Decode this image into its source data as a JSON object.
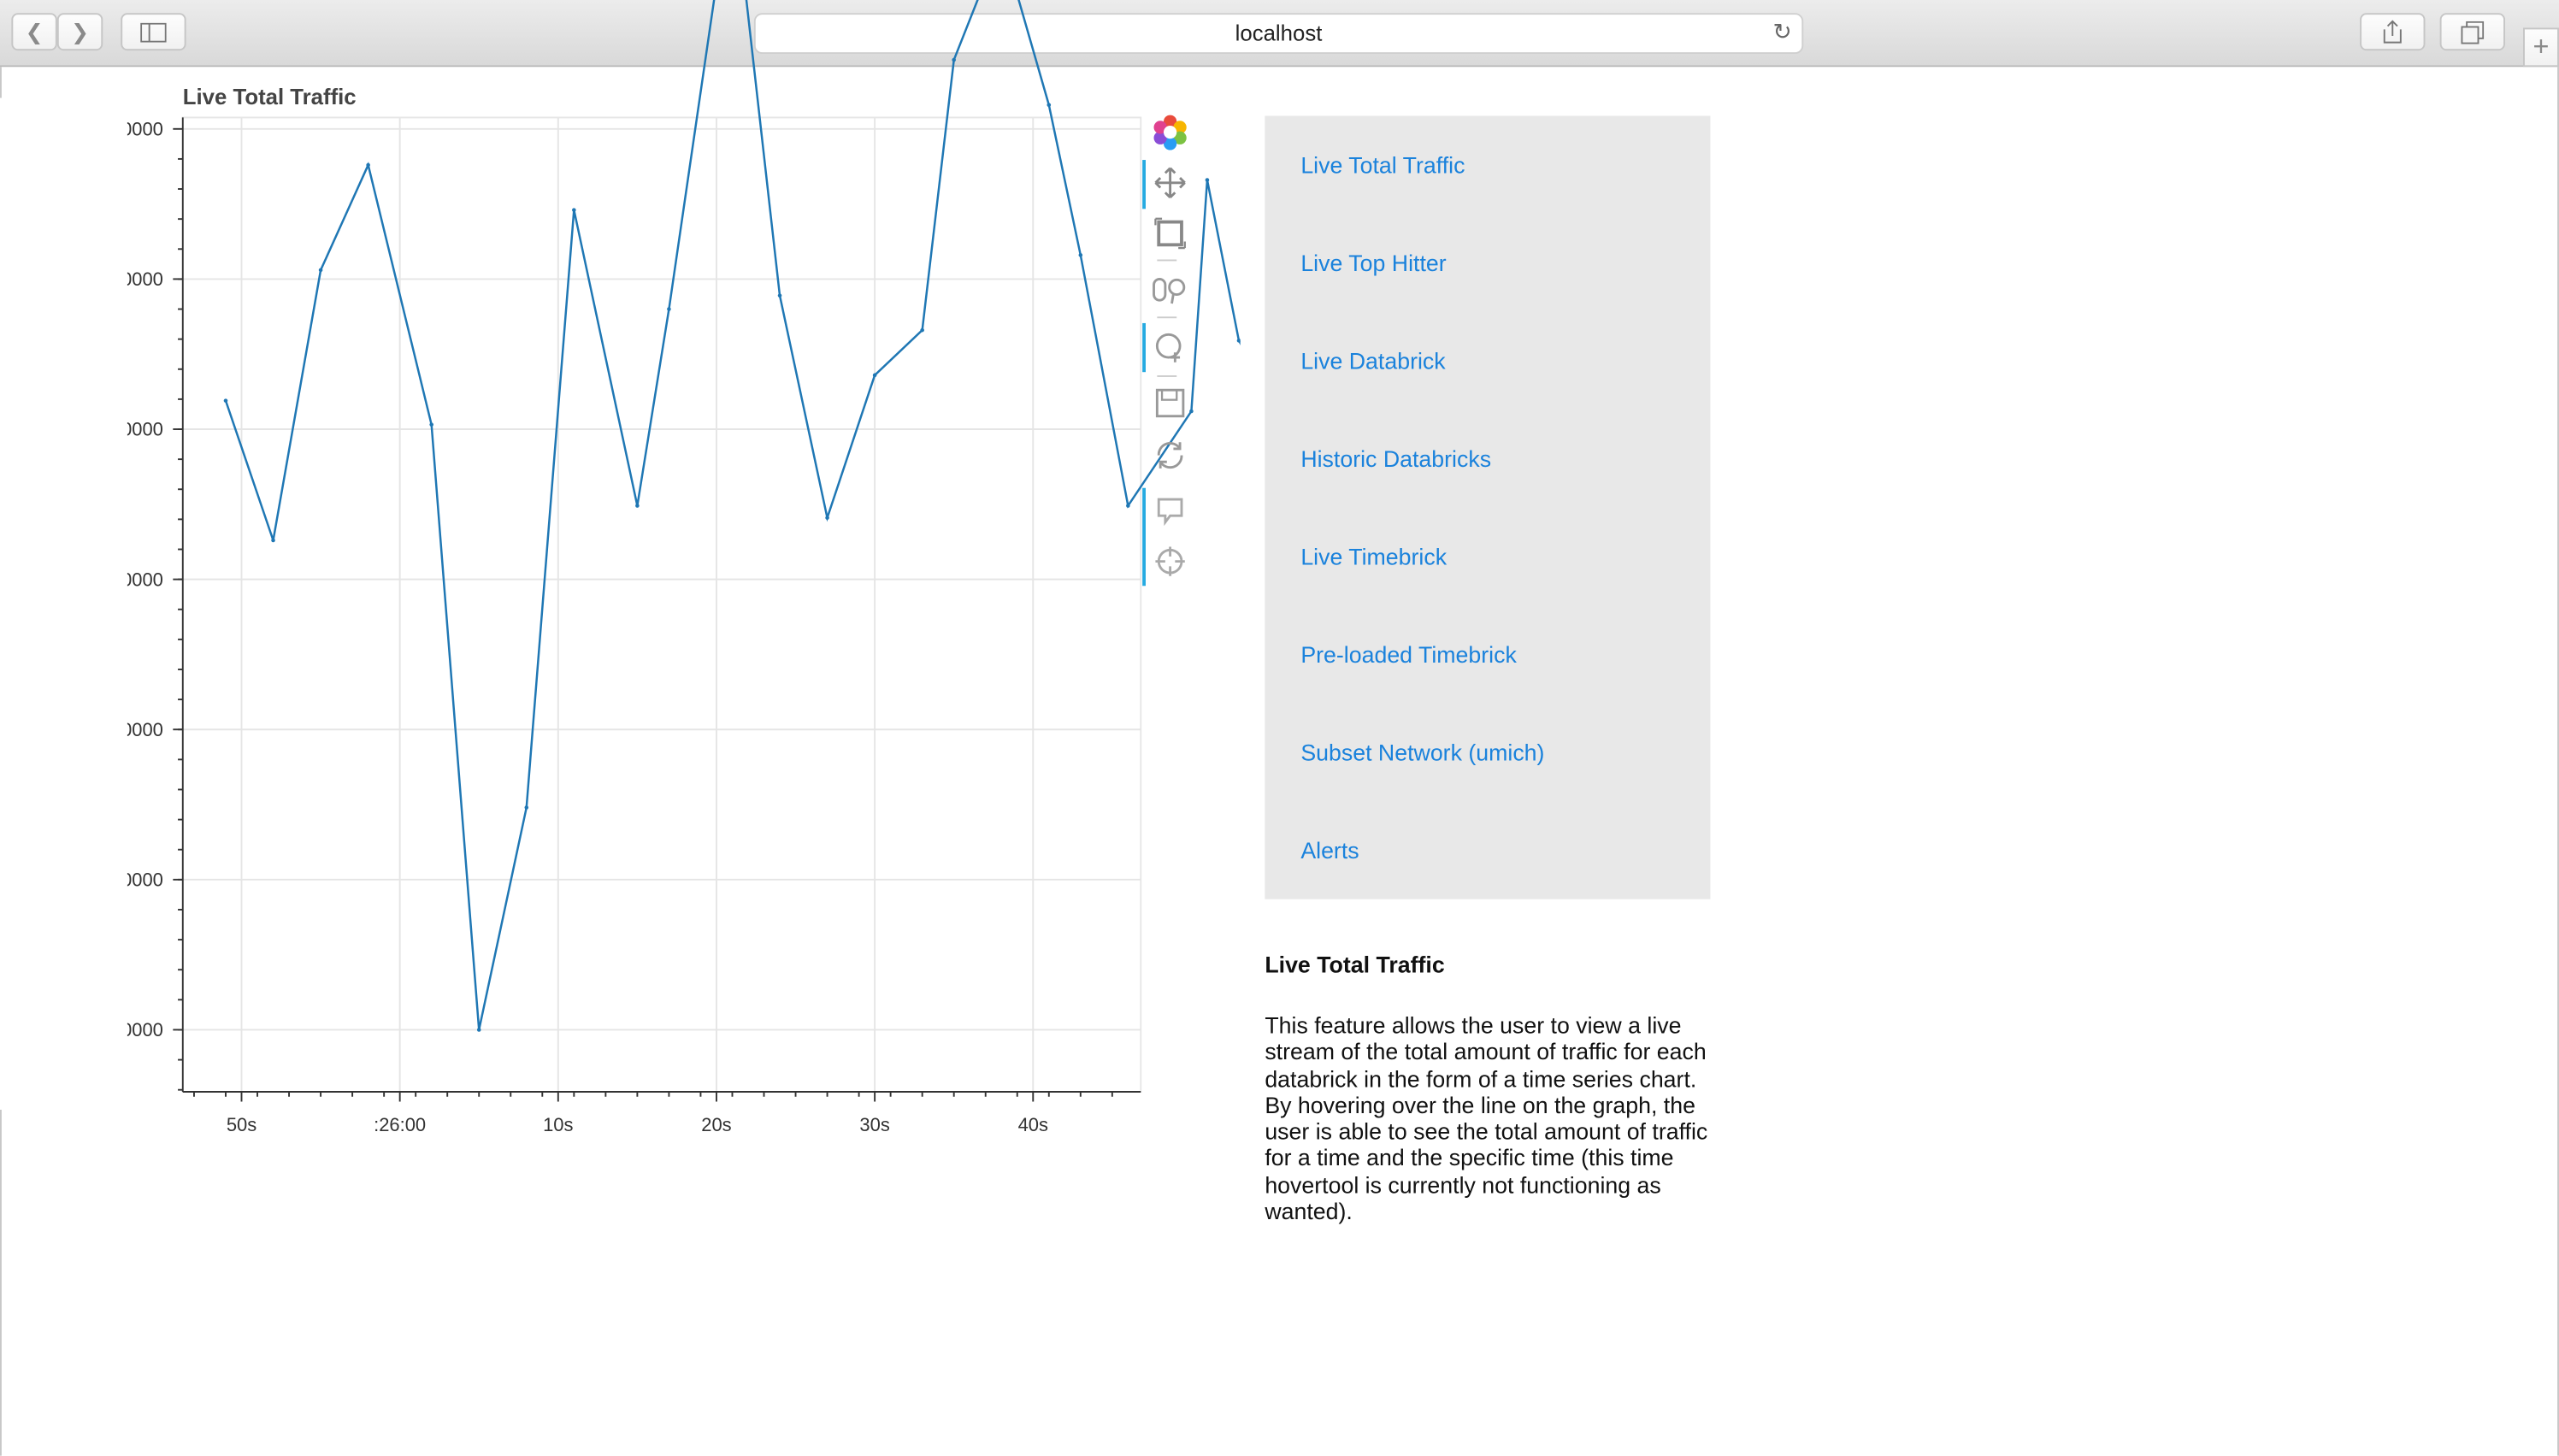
{
  "browser": {
    "url": "localhost",
    "back_icon": "chevron-left-icon",
    "forward_icon": "chevron-right-icon",
    "sidebar_icon": "sidebar-icon",
    "reload_icon": "reload-icon",
    "share_icon": "share-icon",
    "tabs_icon": "tabs-icon",
    "new_tab_icon": "plus-icon"
  },
  "chart_data": {
    "type": "line",
    "title": "Live Total Traffic",
    "xlabel": "",
    "ylabel": "",
    "x_tick_labels": [
      "50s",
      ":26:00",
      "10s",
      "20s",
      "30s",
      "40s"
    ],
    "y_tick_labels": [
      "0000",
      "0000",
      "0000",
      "0000",
      "0000",
      "0000",
      "0000"
    ],
    "x_unit": "seconds after :25:50",
    "x": [
      -1.0,
      2.0,
      5.0,
      8.0,
      12.0,
      15.0,
      18.0,
      21.0,
      25.0,
      27.0,
      31.0,
      34.0,
      37.0,
      40.0,
      43.0,
      45.0,
      48.0,
      51.0,
      53.0,
      56.0,
      60.0,
      61.0,
      63.0,
      66.0
    ],
    "y": [
      2.33,
      1.4,
      3.2,
      3.9,
      2.17,
      -1.86,
      -0.38,
      3.6,
      1.63,
      2.94,
      5.83,
      3.03,
      1.55,
      2.5,
      2.8,
      4.6,
      5.4,
      4.3,
      3.3,
      1.63,
      2.26,
      3.8,
      2.73,
      2.18
    ],
    "color": "#1f77b4",
    "grid": true,
    "toolbar_position": "right"
  },
  "tools": [
    {
      "name": "bokeh-logo-icon"
    },
    {
      "name": "pan-icon"
    },
    {
      "name": "box-zoom-icon"
    },
    {
      "name": "wheel-zoom-icon"
    },
    {
      "name": "zoom-in-icon"
    },
    {
      "name": "save-icon"
    },
    {
      "name": "reset-icon"
    },
    {
      "name": "hover-icon"
    },
    {
      "name": "crosshair-icon"
    }
  ],
  "nav": [
    {
      "label": "Live Total Traffic"
    },
    {
      "label": "Live Top Hitter"
    },
    {
      "label": "Live Databrick"
    },
    {
      "label": "Historic Databricks"
    },
    {
      "label": "Live Timebrick"
    },
    {
      "label": "Pre-loaded Timebrick"
    },
    {
      "label": "Subset Network (umich)"
    },
    {
      "label": "Alerts"
    }
  ],
  "description": {
    "title": "Live Total Traffic",
    "text": "This feature allows the user to view a live stream of the total amount of traffic for each databrick in the form of a time series chart. By hovering over the line on the graph, the user is able to see the total amount of traffic for a time and the specific time (this time hovertool is currently not functioning as wanted)."
  }
}
